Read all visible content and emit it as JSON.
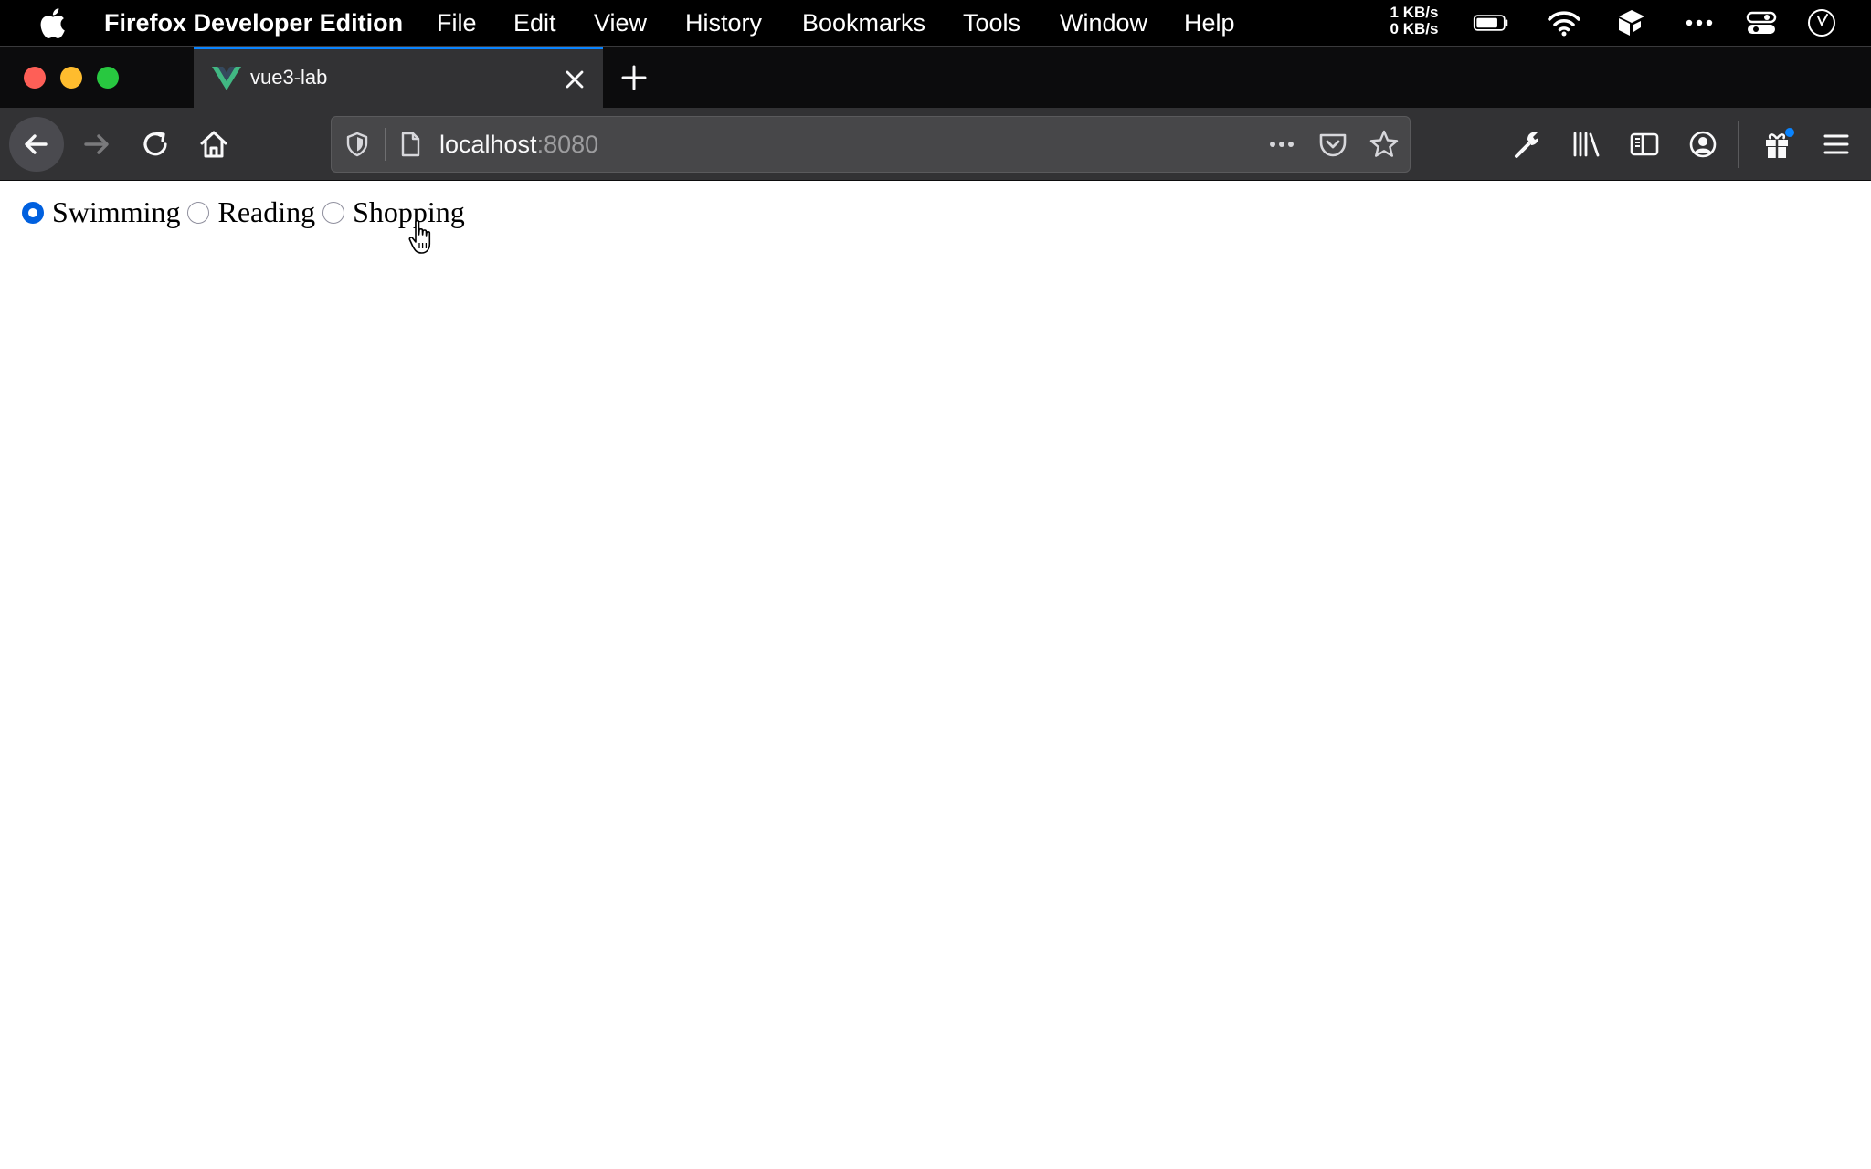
{
  "menubar": {
    "app_name": "Firefox Developer Edition",
    "items": [
      "File",
      "Edit",
      "View",
      "History",
      "Bookmarks",
      "Tools",
      "Window",
      "Help"
    ],
    "net_up": "1 KB/s",
    "net_down": "0 KB/s"
  },
  "tab": {
    "title": "vue3-lab",
    "icon": "vue-logo-icon",
    "accent_color": "#0a84ff"
  },
  "urlbar": {
    "host": "localhost",
    "port": ":8080"
  },
  "page": {
    "radio_options": [
      {
        "label": "Swimming",
        "checked": true
      },
      {
        "label": "Reading",
        "checked": false
      },
      {
        "label": "Shopping",
        "checked": false
      }
    ],
    "radio_checked_color": "#0060df"
  }
}
